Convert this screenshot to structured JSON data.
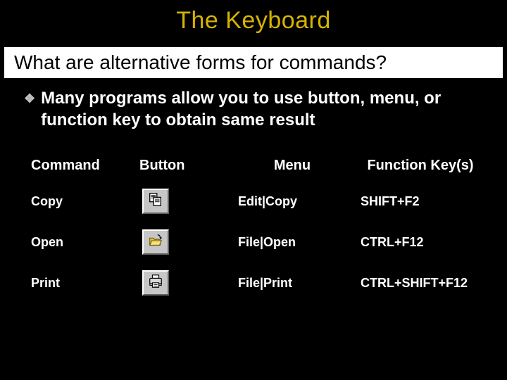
{
  "title": "The Keyboard",
  "subtitle": "What are alternative forms for commands?",
  "bullet_text": "Many programs allow you to use button, menu, or function key to obtain same result",
  "bullet_glyph": "❖",
  "headers": {
    "command": "Command",
    "button": "Button",
    "menu": "Menu",
    "fkey": "Function Key(s)"
  },
  "rows": [
    {
      "command": "Copy",
      "icon": "copy-icon",
      "menu": "Edit|Copy",
      "fkey": "SHIFT+F2"
    },
    {
      "command": "Open",
      "icon": "open-icon",
      "menu": "File|Open",
      "fkey": "CTRL+F12"
    },
    {
      "command": "Print",
      "icon": "print-icon",
      "menu": "File|Print",
      "fkey": "CTRL+SHIFT+F12"
    }
  ]
}
